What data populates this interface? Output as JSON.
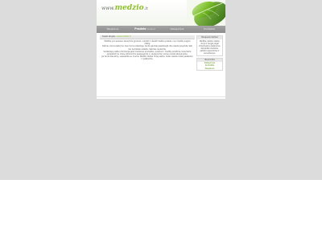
{
  "header": {
    "logo_prefix": "www.",
    "logo_brand": "medzio",
    "logo_tld": ".lt"
  },
  "nav": {
    "items": [
      {
        "label": "Naujienos",
        "sub": ""
      },
      {
        "label": "Pradzia",
        "sub": "Svetaine"
      },
      {
        "label": "Kategorijos",
        "sub": ""
      },
      {
        "label": "Kontaktai",
        "sub": ""
      }
    ]
  },
  "content": {
    "heading": "Sveiki atvyke",
    "heading_highlight": "i www.medzio.lt",
    "paragraphs": [
      "Medžiai yra seniausi sausumos gyvūnai, nukirsti ir išvežti medžių prekės, nuo medžių augina mišką.",
      "Dažnai, kad surastų tai, kas mums reikalinga, tenka gerokai pasistengti. Ne visada pavyksta rasti tai, ką tiksliai ieškote. Sėkmės renkantis.",
      "Svetainėje rasite informaciją apie medienos produktus, įrankius ir medžių priežiūrą. Kviečiame susipažinti su mūsų siūlomomis paslaugomis ir naujienomis, kurias nuolat atnaujiname.",
      "Jei turite klausimų, susisiekite su mumis. Medžio darbai mūsų aistra, todėl visada mielai padėsime ir patarsime."
    ]
  },
  "sidebar": {
    "box1_title": "Naujausi darbai",
    "box1_text": "Medžiai, baldai, laiptai, durys ir langai pagal individualius užsakymus. Kokybiška mediena, patikimi sprendimai ir konsultacijos.",
    "box2_title": "Nuorodos",
    "links": [
      "Kategorijos",
      "Kontaktai",
      "Naujienos"
    ]
  }
}
